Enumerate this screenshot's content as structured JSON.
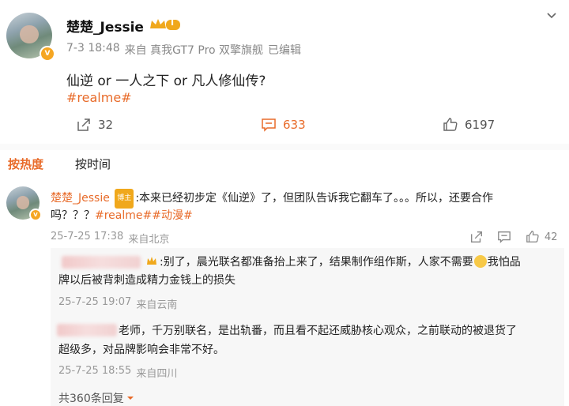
{
  "post": {
    "username": "楚楚_Jessie",
    "level_badge": "I",
    "time": "7-3 18:48",
    "source": "来自 真我GT7 Pro 双擎旗舰",
    "edited": "已编辑",
    "text": "仙逆 or 一人之下 or 凡人修仙传?",
    "hashtag": "#realme#",
    "reposts": "32",
    "comments": "633",
    "likes": "6197"
  },
  "sort_tabs": {
    "hot": "按热度",
    "time": "按时间"
  },
  "comment": {
    "username": "楚楚_Jessie",
    "badge": "博主",
    "text_line1": ":本来已经初步定《仙逆》了，但团队告诉我它翻车了。。。所以，还要合作",
    "text_line2_prefix": "吗？？？",
    "tag1": "#realme#",
    "tag2": "#动漫#",
    "time": "25-7-25 17:38",
    "location": "来自北京",
    "likes": "42"
  },
  "replies": [
    {
      "text_line1": ":别了，晨光联名都准备抬上来了，结果制作组作斯，人家不需要",
      "text_line1_end": "我怕品",
      "text_line2": "牌以后被背刺造成精力金钱上的损失",
      "time": "25-7-25 19:07",
      "location": "来自云南"
    },
    {
      "text_line1": "老师，千万别联名，是出轨番，而且看不起还威胁核心观众，之前联动的被退货了",
      "text_line2": "超级多，对品牌影响会非常不好。",
      "time": "25-7-25 18:55",
      "location": "来自四川"
    }
  ],
  "more_replies": "共360条回复",
  "colors": {
    "accent": "#e86b2a",
    "meta": "#888888"
  }
}
